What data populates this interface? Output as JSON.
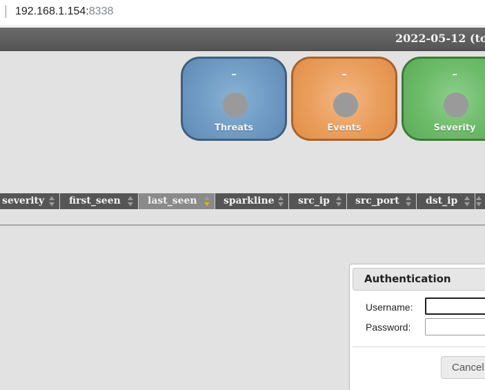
{
  "browser": {
    "url_host": "192.168.1.154:",
    "url_port": "8338"
  },
  "header": {
    "date_text": "2022-05-12 (to"
  },
  "counters": [
    {
      "value": "–",
      "label": "Threats",
      "color": "#6f9bc4"
    },
    {
      "value": "–",
      "label": "Events",
      "color": "#ea9e5c"
    },
    {
      "value": "–",
      "label": "Severity",
      "color": "#6cbb69"
    }
  ],
  "table": {
    "columns": [
      {
        "label": "severity"
      },
      {
        "label": "first_seen"
      },
      {
        "label": "last_seen",
        "sorted": "descending"
      },
      {
        "label": "sparkline"
      },
      {
        "label": "src_ip"
      },
      {
        "label": "src_port"
      },
      {
        "label": "dst_ip"
      }
    ]
  },
  "auth_dialog": {
    "title": "Authentication",
    "username_label": "Username:",
    "username_value": "",
    "password_label": "Password:",
    "password_value": "",
    "cancel_label": "Cancel"
  },
  "colors": {
    "header_bg": "#555555",
    "sort_active": "#e8b100",
    "page_bg": "#e2e2e2"
  }
}
